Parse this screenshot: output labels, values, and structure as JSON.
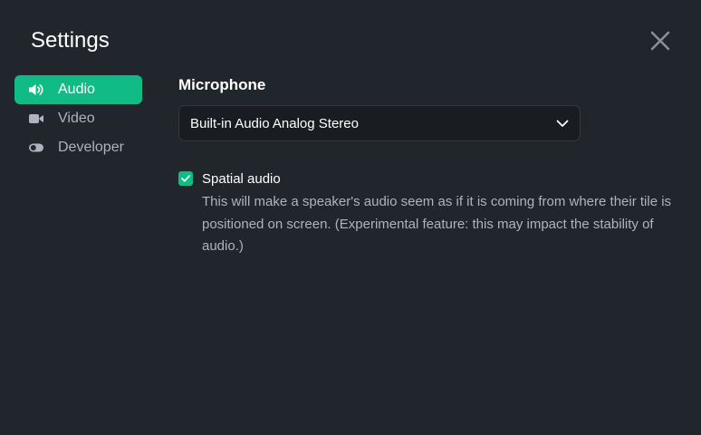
{
  "dialog": {
    "title": "Settings"
  },
  "sidebar": {
    "items": [
      {
        "label": "Audio",
        "icon": "speaker-icon",
        "active": true
      },
      {
        "label": "Video",
        "icon": "video-camera-icon",
        "active": false
      },
      {
        "label": "Developer",
        "icon": "toggle-icon",
        "active": false
      }
    ]
  },
  "audio": {
    "microphone_heading": "Microphone",
    "microphone_value": "Built-in Audio Analog Stereo",
    "spatial_label": "Spatial audio",
    "spatial_checked": true,
    "spatial_description": "This will make a speaker's audio seem as if it is coming from where their tile is positioned on screen. (Experimental feature: this may impact the stability of audio.)"
  },
  "colors": {
    "background": "#21252c",
    "accent": "#10bb86",
    "muted_text": "#aeb4bd"
  }
}
